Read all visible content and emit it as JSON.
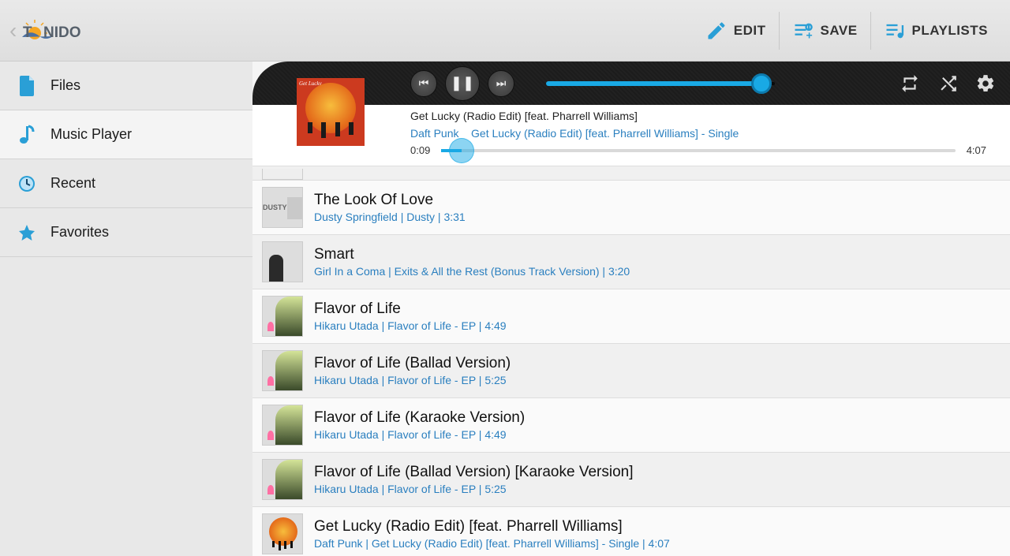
{
  "app": {
    "name": "TONIDO"
  },
  "header": {
    "edit": "EDIT",
    "save": "SAVE",
    "playlists": "PLAYLISTS"
  },
  "sidebar": {
    "items": [
      {
        "label": "Files"
      },
      {
        "label": "Music Player"
      },
      {
        "label": "Recent"
      },
      {
        "label": "Favorites"
      }
    ],
    "active_index": 1
  },
  "player": {
    "state": "paused",
    "volume_pct": 94,
    "elapsed": "0:09",
    "duration": "4:07",
    "progress_pct": 4,
    "track_title": "Get Lucky (Radio Edit) [feat. Pharrell Williams]",
    "artist": "Daft Punk",
    "album": "Get Lucky (Radio Edit) [feat. Pharrell Williams] - Single"
  },
  "tracks": [
    {
      "title": "The Look Of Love",
      "sub": "Dusty Springfield | Dusty | 3:31",
      "cover": "dusty",
      "alt": false
    },
    {
      "title": "Smart",
      "sub": "Girl In a Coma | Exits & All the Rest (Bonus Track Version) | 3:20",
      "cover": "girl",
      "alt": true
    },
    {
      "title": "Flavor of Life",
      "sub": "Hikaru Utada | Flavor of Life - EP | 4:49",
      "cover": "hikaru",
      "alt": false
    },
    {
      "title": "Flavor of Life (Ballad Version)",
      "sub": "Hikaru Utada | Flavor of Life - EP | 5:25",
      "cover": "hikaru",
      "alt": true
    },
    {
      "title": "Flavor of Life (Karaoke Version)",
      "sub": "Hikaru Utada | Flavor of Life - EP | 4:49",
      "cover": "hikaru",
      "alt": false
    },
    {
      "title": "Flavor of Life (Ballad Version) [Karaoke Version]",
      "sub": "Hikaru Utada | Flavor of Life - EP | 5:25",
      "cover": "hikaru",
      "alt": true
    },
    {
      "title": "Get Lucky (Radio Edit) [feat. Pharrell Williams]",
      "sub": "Daft Punk | Get Lucky (Radio Edit) [feat. Pharrell Williams] - Single | 4:07",
      "cover": "daft",
      "alt": false
    }
  ]
}
